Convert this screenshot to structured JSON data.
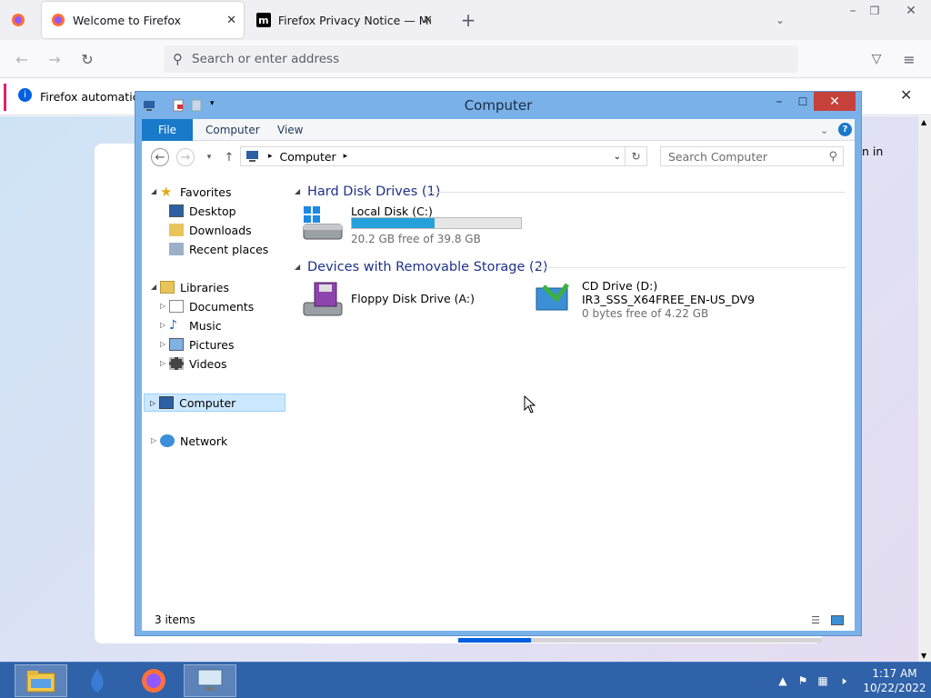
{
  "browser": {
    "tabs": [
      {
        "title": "Welcome to Firefox"
      },
      {
        "title": "Firefox Privacy Notice — Mozilla"
      }
    ],
    "url_placeholder": "Search or enter address",
    "notification": "Firefox automaticall",
    "partial_text": "n in",
    "progress": 0.2
  },
  "explorer": {
    "title": "Computer",
    "ribbon_tabs": [
      "File",
      "Computer",
      "View"
    ],
    "address": "Computer",
    "search_placeholder": "Search Computer",
    "nav": {
      "favorites": "Favorites",
      "desktop": "Desktop",
      "downloads": "Downloads",
      "recent": "Recent places",
      "libraries": "Libraries",
      "documents": "Documents",
      "music": "Music",
      "pictures": "Pictures",
      "videos": "Videos",
      "computer": "Computer",
      "network": "Network"
    },
    "groups": {
      "hdd": "Hard Disk Drives (1)",
      "removable": "Devices with Removable Storage (2)"
    },
    "drives": {
      "c": {
        "name": "Local Disk (C:)",
        "free": "20.2 GB free of 39.8 GB",
        "used_fraction": 0.49
      },
      "a": {
        "name": "Floppy Disk Drive (A:)"
      },
      "d": {
        "name": "CD Drive (D:)",
        "label": "IR3_SSS_X64FREE_EN-US_DV9",
        "free": "0 bytes free of 4.22 GB"
      }
    },
    "status": "3 items"
  },
  "taskbar": {
    "time": "1:17 AM",
    "date": "10/22/2022"
  }
}
